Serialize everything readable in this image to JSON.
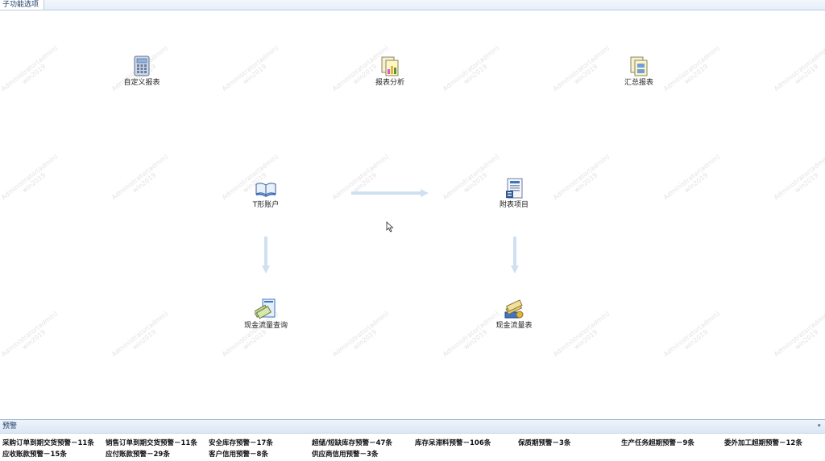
{
  "tab": {
    "label": "子功能选项"
  },
  "watermark": {
    "line1": "Administrator(admin)",
    "line2": "win2019"
  },
  "nodes": {
    "custom_report": "自定义报表",
    "report_analysis": "报表分析",
    "summary_report": "汇总报表",
    "t_account": "T形账户",
    "appendix_items": "附表项目",
    "cashflow_query": "现金流量查询",
    "cashflow_table": "现金流量表"
  },
  "warning": {
    "title": "预警",
    "items": [
      "采购订单到期交货预警－11条",
      "销售订单到期交货预警－11条",
      "安全库存预警－17条",
      "超储/短缺库存预警－47条",
      "库存呆滞料预警－106条",
      "保质期预警－3条",
      "生产任务超期预警－9条",
      "委外加工超期预警－12条",
      "应收账款预警－15条",
      "应付账款预警－29条",
      "客户信用预警－8条",
      "供应商信用预警－3条"
    ]
  }
}
